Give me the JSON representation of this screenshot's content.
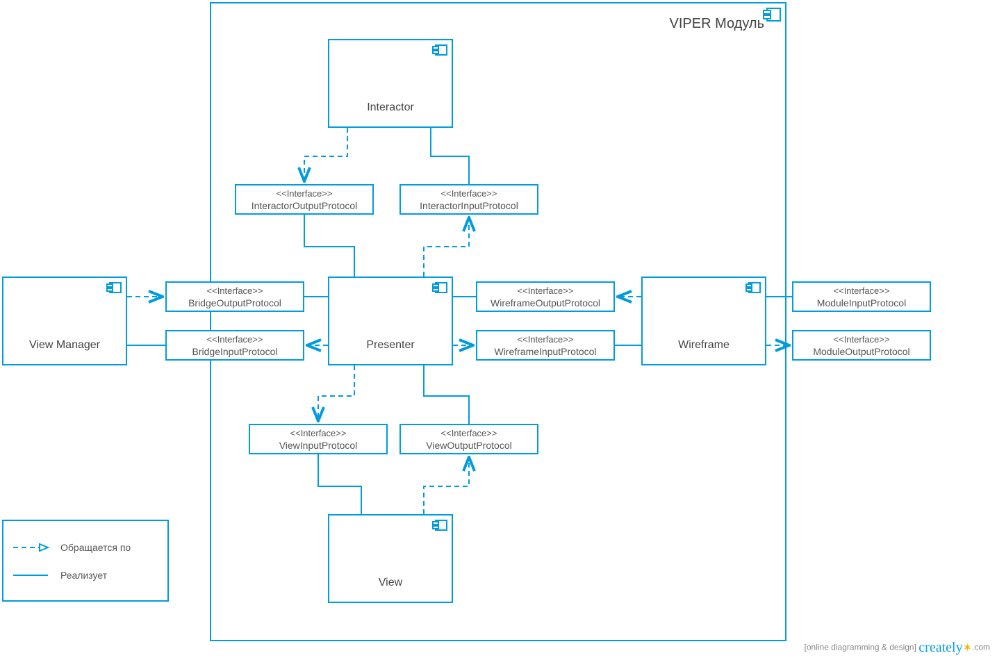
{
  "module": {
    "title": "VIPER Модуль"
  },
  "components": {
    "interactor": "Interactor",
    "presenter": "Presenter",
    "view": "View",
    "wireframe": "Wireframe",
    "viewManager": "View Manager"
  },
  "interfaces": {
    "stereotype": "<<Interface>>",
    "interactorOutput": "InteractorOutputProtocol",
    "interactorInput": "InteractorInputProtocol",
    "bridgeOutput": "BridgeOutputProtocol",
    "bridgeInput": "BridgeInputProtocol",
    "wireframeOutput": "WireframeOutputProtocol",
    "wireframeInput": "WireframeInputProtocol",
    "moduleInput": "ModuleInputProtocol",
    "moduleOutput": "ModuleOutputProtocol",
    "viewInput": "ViewInputProtocol",
    "viewOutput": "ViewOutputProtocol"
  },
  "legend": {
    "accesses": "Обращается по",
    "implements": "Реализует"
  },
  "footer": {
    "tag": "[online diagramming & design]",
    "brand": "creately",
    "tld": ".com"
  },
  "colors": {
    "accent": "#009cde"
  }
}
